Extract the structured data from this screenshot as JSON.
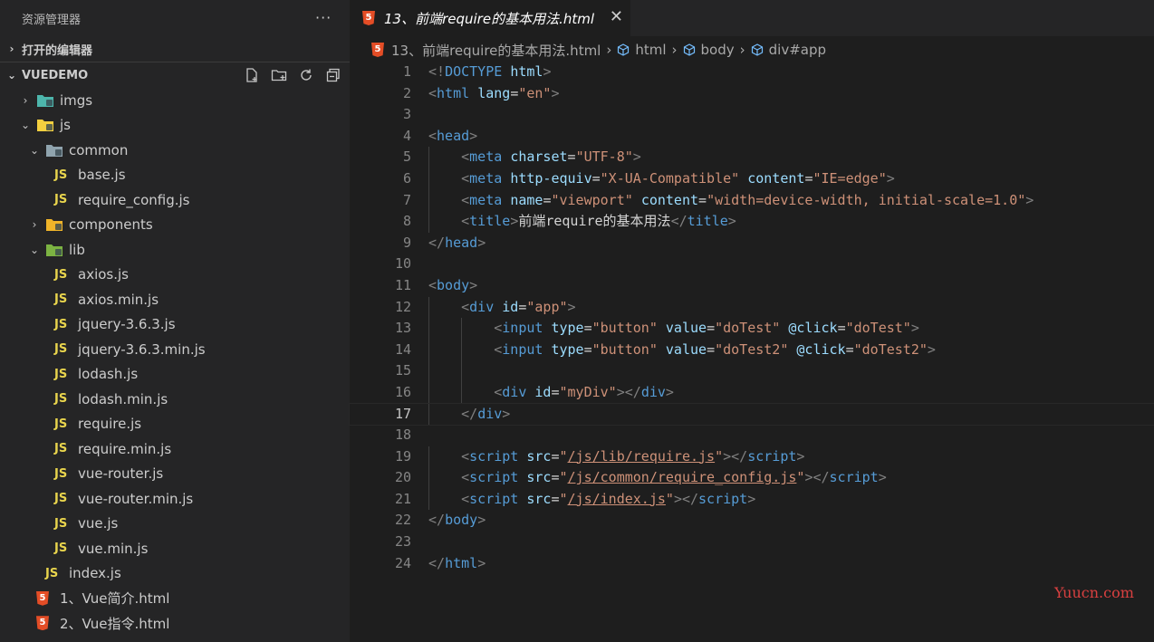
{
  "sidebar": {
    "title": "资源管理器",
    "more": "···",
    "open_editors": "打开的编辑器",
    "project": "VUEDEMO",
    "tree": [
      {
        "label": "imgs",
        "depth": 0,
        "twisty": "›",
        "icon": "folder-images"
      },
      {
        "label": "js",
        "depth": 0,
        "twisty": "⌄",
        "icon": "folder-js"
      },
      {
        "label": "common",
        "depth": 1,
        "twisty": "⌄",
        "icon": "folder-common"
      },
      {
        "label": "base.js",
        "depth": 2,
        "twisty": "",
        "icon": "js"
      },
      {
        "label": "require_config.js",
        "depth": 2,
        "twisty": "",
        "icon": "js"
      },
      {
        "label": "components",
        "depth": 1,
        "twisty": "›",
        "icon": "folder-components"
      },
      {
        "label": "lib",
        "depth": 1,
        "twisty": "⌄",
        "icon": "folder-lib"
      },
      {
        "label": "axios.js",
        "depth": 2,
        "twisty": "",
        "icon": "js"
      },
      {
        "label": "axios.min.js",
        "depth": 2,
        "twisty": "",
        "icon": "js"
      },
      {
        "label": "jquery-3.6.3.js",
        "depth": 2,
        "twisty": "",
        "icon": "js"
      },
      {
        "label": "jquery-3.6.3.min.js",
        "depth": 2,
        "twisty": "",
        "icon": "js"
      },
      {
        "label": "lodash.js",
        "depth": 2,
        "twisty": "",
        "icon": "js"
      },
      {
        "label": "lodash.min.js",
        "depth": 2,
        "twisty": "",
        "icon": "js"
      },
      {
        "label": "require.js",
        "depth": 2,
        "twisty": "",
        "icon": "js"
      },
      {
        "label": "require.min.js",
        "depth": 2,
        "twisty": "",
        "icon": "js"
      },
      {
        "label": "vue-router.js",
        "depth": 2,
        "twisty": "",
        "icon": "js"
      },
      {
        "label": "vue-router.min.js",
        "depth": 2,
        "twisty": "",
        "icon": "js"
      },
      {
        "label": "vue.js",
        "depth": 2,
        "twisty": "",
        "icon": "js"
      },
      {
        "label": "vue.min.js",
        "depth": 2,
        "twisty": "",
        "icon": "js"
      },
      {
        "label": "index.js",
        "depth": 1,
        "twisty": "",
        "icon": "js"
      },
      {
        "label": "1、Vue简介.html",
        "depth": 0,
        "twisty": "",
        "icon": "html"
      },
      {
        "label": "2、Vue指令.html",
        "depth": 0,
        "twisty": "",
        "icon": "html"
      }
    ]
  },
  "tab": {
    "label": "13、前端require的基本用法.html",
    "close": "✕"
  },
  "breadcrumb": [
    "13、前端require的基本用法.html",
    "html",
    "body",
    "div#app"
  ],
  "icons": {
    "js_badge": "JS",
    "html5_badge": "5",
    "twisty_open": "⌄",
    "twisty_closed": "›"
  },
  "code_lines": [
    {
      "n": "1",
      "indent": 0,
      "tokens": [
        [
          "p",
          "<!"
        ],
        [
          "t",
          "DOCTYPE"
        ],
        [
          "x",
          " "
        ],
        [
          "a",
          "html"
        ],
        [
          "p",
          ">"
        ]
      ]
    },
    {
      "n": "2",
      "indent": 0,
      "tokens": [
        [
          "p",
          "<"
        ],
        [
          "t",
          "html"
        ],
        [
          "x",
          " "
        ],
        [
          "a",
          "lang"
        ],
        [
          "x",
          "="
        ],
        [
          "s",
          "\"en\""
        ],
        [
          "p",
          ">"
        ]
      ]
    },
    {
      "n": "3",
      "indent": 0,
      "tokens": []
    },
    {
      "n": "4",
      "indent": 0,
      "tokens": [
        [
          "p",
          "<"
        ],
        [
          "t",
          "head"
        ],
        [
          "p",
          ">"
        ]
      ]
    },
    {
      "n": "5",
      "indent": 1,
      "tokens": [
        [
          "x",
          "    "
        ],
        [
          "p",
          "<"
        ],
        [
          "t",
          "meta"
        ],
        [
          "x",
          " "
        ],
        [
          "a",
          "charset"
        ],
        [
          "x",
          "="
        ],
        [
          "s",
          "\"UTF-8\""
        ],
        [
          "p",
          ">"
        ]
      ]
    },
    {
      "n": "6",
      "indent": 1,
      "tokens": [
        [
          "x",
          "    "
        ],
        [
          "p",
          "<"
        ],
        [
          "t",
          "meta"
        ],
        [
          "x",
          " "
        ],
        [
          "a",
          "http-equiv"
        ],
        [
          "x",
          "="
        ],
        [
          "s",
          "\"X-UA-Compatible\""
        ],
        [
          "x",
          " "
        ],
        [
          "a",
          "content"
        ],
        [
          "x",
          "="
        ],
        [
          "s",
          "\"IE=edge\""
        ],
        [
          "p",
          ">"
        ]
      ]
    },
    {
      "n": "7",
      "indent": 1,
      "tokens": [
        [
          "x",
          "    "
        ],
        [
          "p",
          "<"
        ],
        [
          "t",
          "meta"
        ],
        [
          "x",
          " "
        ],
        [
          "a",
          "name"
        ],
        [
          "x",
          "="
        ],
        [
          "s",
          "\"viewport\""
        ],
        [
          "x",
          " "
        ],
        [
          "a",
          "content"
        ],
        [
          "x",
          "="
        ],
        [
          "s",
          "\"width=device-width, initial-scale=1.0\""
        ],
        [
          "p",
          ">"
        ]
      ]
    },
    {
      "n": "8",
      "indent": 1,
      "tokens": [
        [
          "x",
          "    "
        ],
        [
          "p",
          "<"
        ],
        [
          "t",
          "title"
        ],
        [
          "p",
          ">"
        ],
        [
          "x",
          "前端require的基本用法"
        ],
        [
          "p",
          "</"
        ],
        [
          "t",
          "title"
        ],
        [
          "p",
          ">"
        ]
      ]
    },
    {
      "n": "9",
      "indent": 0,
      "tokens": [
        [
          "p",
          "</"
        ],
        [
          "t",
          "head"
        ],
        [
          "p",
          ">"
        ]
      ]
    },
    {
      "n": "10",
      "indent": 0,
      "tokens": []
    },
    {
      "n": "11",
      "indent": 0,
      "tokens": [
        [
          "p",
          "<"
        ],
        [
          "t",
          "body"
        ],
        [
          "p",
          ">"
        ]
      ]
    },
    {
      "n": "12",
      "indent": 1,
      "tokens": [
        [
          "x",
          "    "
        ],
        [
          "p",
          "<"
        ],
        [
          "t",
          "div"
        ],
        [
          "x",
          " "
        ],
        [
          "a",
          "id"
        ],
        [
          "x",
          "="
        ],
        [
          "s",
          "\"app\""
        ],
        [
          "p",
          ">"
        ]
      ]
    },
    {
      "n": "13",
      "indent": 2,
      "tokens": [
        [
          "x",
          "        "
        ],
        [
          "p",
          "<"
        ],
        [
          "t",
          "input"
        ],
        [
          "x",
          " "
        ],
        [
          "a",
          "type"
        ],
        [
          "x",
          "="
        ],
        [
          "s",
          "\"button\""
        ],
        [
          "x",
          " "
        ],
        [
          "a",
          "value"
        ],
        [
          "x",
          "="
        ],
        [
          "s",
          "\"doTest\""
        ],
        [
          "x",
          " "
        ],
        [
          "a",
          "@click"
        ],
        [
          "x",
          "="
        ],
        [
          "s",
          "\"doTest\""
        ],
        [
          "p",
          ">"
        ]
      ]
    },
    {
      "n": "14",
      "indent": 2,
      "tokens": [
        [
          "x",
          "        "
        ],
        [
          "p",
          "<"
        ],
        [
          "t",
          "input"
        ],
        [
          "x",
          " "
        ],
        [
          "a",
          "type"
        ],
        [
          "x",
          "="
        ],
        [
          "s",
          "\"button\""
        ],
        [
          "x",
          " "
        ],
        [
          "a",
          "value"
        ],
        [
          "x",
          "="
        ],
        [
          "s",
          "\"doTest2\""
        ],
        [
          "x",
          " "
        ],
        [
          "a",
          "@click"
        ],
        [
          "x",
          "="
        ],
        [
          "s",
          "\"doTest2\""
        ],
        [
          "p",
          ">"
        ]
      ]
    },
    {
      "n": "15",
      "indent": 2,
      "tokens": []
    },
    {
      "n": "16",
      "indent": 2,
      "tokens": [
        [
          "x",
          "        "
        ],
        [
          "p",
          "<"
        ],
        [
          "t",
          "div"
        ],
        [
          "x",
          " "
        ],
        [
          "a",
          "id"
        ],
        [
          "x",
          "="
        ],
        [
          "s",
          "\"myDiv\""
        ],
        [
          "p",
          ">"
        ],
        [
          "p",
          "</"
        ],
        [
          "t",
          "div"
        ],
        [
          "p",
          ">"
        ]
      ]
    },
    {
      "n": "17",
      "indent": 1,
      "current": true,
      "tokens": [
        [
          "x",
          "    "
        ],
        [
          "p",
          "</"
        ],
        [
          "t",
          "div"
        ],
        [
          "p",
          ">"
        ]
      ]
    },
    {
      "n": "18",
      "indent": 0,
      "tokens": []
    },
    {
      "n": "19",
      "indent": 1,
      "tokens": [
        [
          "x",
          "    "
        ],
        [
          "p",
          "<"
        ],
        [
          "t",
          "script"
        ],
        [
          "x",
          " "
        ],
        [
          "a",
          "src"
        ],
        [
          "x",
          "="
        ],
        [
          "s",
          "\""
        ],
        [
          "u",
          "/js/lib/require.js"
        ],
        [
          "s",
          "\""
        ],
        [
          "p",
          ">"
        ],
        [
          "p",
          "</"
        ],
        [
          "t",
          "script"
        ],
        [
          "p",
          ">"
        ]
      ]
    },
    {
      "n": "20",
      "indent": 1,
      "tokens": [
        [
          "x",
          "    "
        ],
        [
          "p",
          "<"
        ],
        [
          "t",
          "script"
        ],
        [
          "x",
          " "
        ],
        [
          "a",
          "src"
        ],
        [
          "x",
          "="
        ],
        [
          "s",
          "\""
        ],
        [
          "u",
          "/js/common/require_config.js"
        ],
        [
          "s",
          "\""
        ],
        [
          "p",
          ">"
        ],
        [
          "p",
          "</"
        ],
        [
          "t",
          "script"
        ],
        [
          "p",
          ">"
        ]
      ]
    },
    {
      "n": "21",
      "indent": 1,
      "tokens": [
        [
          "x",
          "    "
        ],
        [
          "p",
          "<"
        ],
        [
          "t",
          "script"
        ],
        [
          "x",
          " "
        ],
        [
          "a",
          "src"
        ],
        [
          "x",
          "="
        ],
        [
          "s",
          "\""
        ],
        [
          "u",
          "/js/index.js"
        ],
        [
          "s",
          "\""
        ],
        [
          "p",
          ">"
        ],
        [
          "p",
          "</"
        ],
        [
          "t",
          "script"
        ],
        [
          "p",
          ">"
        ]
      ]
    },
    {
      "n": "22",
      "indent": 0,
      "tokens": [
        [
          "p",
          "</"
        ],
        [
          "t",
          "body"
        ],
        [
          "p",
          ">"
        ]
      ]
    },
    {
      "n": "23",
      "indent": 0,
      "tokens": []
    },
    {
      "n": "24",
      "indent": 0,
      "tokens": [
        [
          "p",
          "</"
        ],
        [
          "t",
          "html"
        ],
        [
          "p",
          ">"
        ]
      ]
    }
  ],
  "watermark": "Yuucn.com"
}
